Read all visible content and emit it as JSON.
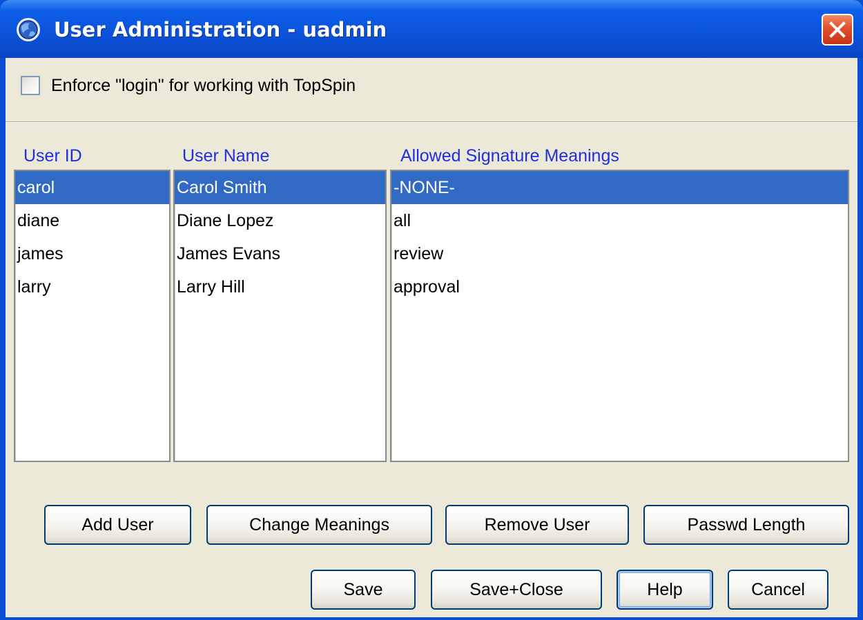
{
  "window": {
    "title": "User Administration - uadmin",
    "icon": "topspin-globe-icon",
    "close_icon": "close-icon"
  },
  "enforce_login": {
    "label": "Enforce \"login\" for working with TopSpin",
    "checked": false
  },
  "columns": {
    "user_id": "User ID",
    "user_name": "User Name",
    "meanings": "Allowed Signature Meanings"
  },
  "user_ids": [
    "carol",
    "diane",
    "james",
    "larry"
  ],
  "user_names": [
    "Carol Smith",
    "Diane Lopez",
    "James Evans",
    "Larry Hill"
  ],
  "meanings": [
    "-NONE-",
    "all",
    "review",
    "approval"
  ],
  "selected_index": 0,
  "buttons": {
    "add_user": "Add User",
    "change_meanings": "Change Meanings",
    "remove_user": "Remove User",
    "passwd_length": "Passwd Length",
    "save": "Save",
    "save_close": "Save+Close",
    "help": "Help",
    "cancel": "Cancel"
  },
  "colors": {
    "selection": "#316ac5",
    "header_text": "#1f2fe0",
    "titlebar": "#0a53db"
  }
}
